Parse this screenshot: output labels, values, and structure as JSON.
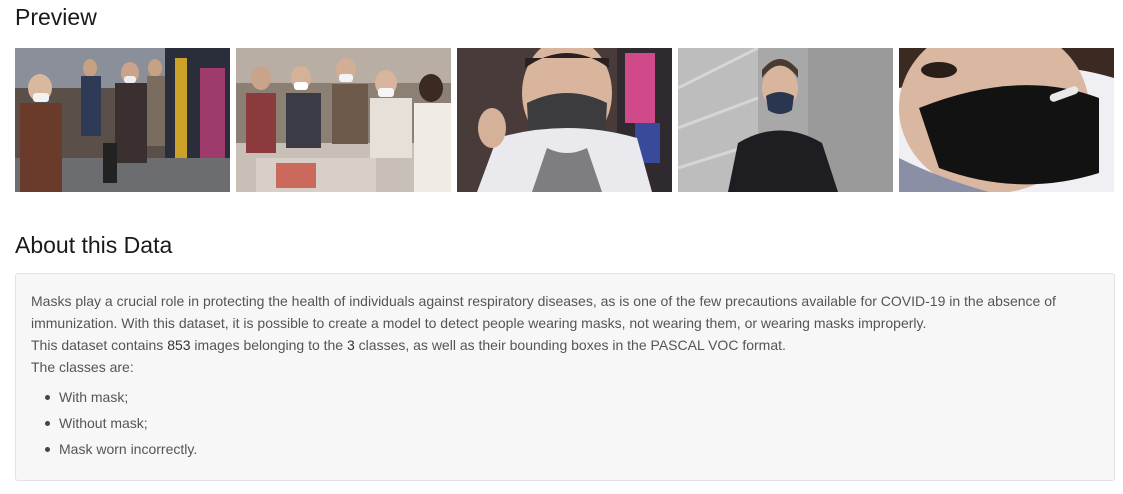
{
  "preview": {
    "title": "Preview",
    "images": [
      {
        "alt": "People wearing masks walking in a subway station"
      },
      {
        "alt": "Crowd wearing masks at a market counter"
      },
      {
        "alt": "Person wearing a dark grey mask"
      },
      {
        "alt": "Man wearing a dark mask sitting on stairs"
      },
      {
        "alt": "Close-up of a person wearing a black mask with valve"
      }
    ]
  },
  "about": {
    "title": "About this Data",
    "paragraph_1a": "Masks play a crucial role in protecting the health of individuals against respiratory diseases, as is one of the few precautions available for COVID-19 in the absence of immunization. With this dataset, it is possible to create a model to detect people wearing masks, not wearing them, or wearing masks improperly.",
    "paragraph_1b_prefix": "This dataset contains ",
    "image_count": "853",
    "paragraph_1b_mid": " images belonging to the ",
    "class_count": "3",
    "paragraph_1b_suffix": " classes, as well as their bounding boxes in the PASCAL VOC format.",
    "classes_intro": "The classes are:",
    "classes": [
      "With mask;",
      "Without mask;",
      "Mask worn incorrectly."
    ]
  }
}
